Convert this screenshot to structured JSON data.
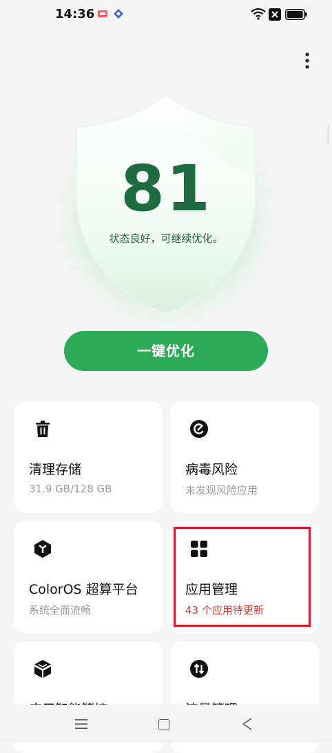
{
  "status_bar": {
    "time": "14:36",
    "icons": [
      "notification-app-icon",
      "notification-shield-icon",
      "wifi-icon",
      "no-sim-icon",
      "battery-icon"
    ]
  },
  "header": {
    "menu_icon": "more-vertical-icon"
  },
  "score": {
    "value": "81",
    "description": "状态良好，可继续优化。"
  },
  "optimize_button": {
    "label": "一键优化"
  },
  "cards": [
    {
      "icon": "trash-icon",
      "title": "清理存储",
      "subtitle": "31.9 GB/128 GB"
    },
    {
      "icon": "virus-shield-icon",
      "title": "病毒风险",
      "subtitle": "未发现风险应用"
    },
    {
      "icon": "coloros-cube-icon",
      "title": "ColorOS 超算平台",
      "subtitle": "系统全面流畅"
    },
    {
      "icon": "apps-grid-icon",
      "title": "应用管理",
      "subtitle": "43 个应用待更新"
    },
    {
      "icon": "app-guard-icon",
      "title": "应用智能管控",
      "subtitle": ""
    },
    {
      "icon": "data-traffic-icon",
      "title": "流量管理",
      "subtitle": ""
    }
  ],
  "colors": {
    "accent_green": "#2daa55",
    "score_green": "#1d6b3e",
    "warning_red": "#e03a2e",
    "highlight_red": "#e8132b",
    "background": "#f5f5f5"
  },
  "nav_bar": {
    "icons": [
      "menu-icon",
      "home-icon",
      "back-icon"
    ]
  }
}
